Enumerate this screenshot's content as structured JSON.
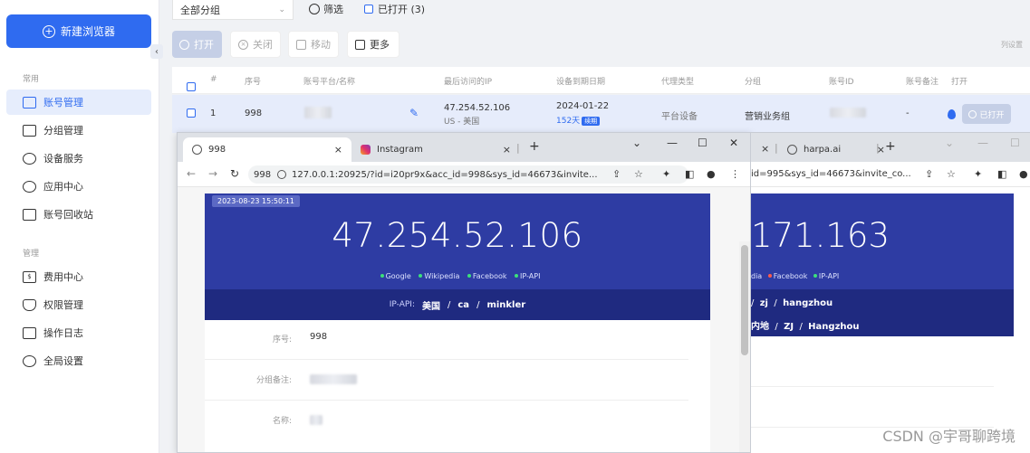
{
  "sidebar": {
    "new_browser": "新建浏览器",
    "section_common": "常用",
    "section_manage": "管理",
    "items": [
      {
        "label": "账号管理"
      },
      {
        "label": "分组管理"
      },
      {
        "label": "设备服务"
      },
      {
        "label": "应用中心"
      },
      {
        "label": "账号回收站"
      },
      {
        "label": "费用中心"
      },
      {
        "label": "权限管理"
      },
      {
        "label": "操作日志"
      },
      {
        "label": "全局设置"
      }
    ]
  },
  "filters": {
    "group_select": "全部分组",
    "filter_label": "筛选",
    "opened_label": "已打开 (3)"
  },
  "toolbar": {
    "open": "打开",
    "close": "关闭",
    "move": "移动",
    "more": "更多",
    "column_setting": "列设置"
  },
  "table": {
    "headers": [
      "#",
      "序号",
      "账号平台/名称",
      "最后访问的IP",
      "设备到期日期",
      "代理类型",
      "分组",
      "账号ID",
      "账号备注",
      "打开"
    ],
    "row": {
      "index": "1",
      "serial": "998",
      "ip": "47.254.52.106",
      "ip_location": "US - 美国",
      "expire_date": "2024-01-22",
      "expire_days": "152天",
      "renew": "续期",
      "proxy_type": "平台设备",
      "group": "营销业务组",
      "note": "-",
      "opened_btn": "已打开"
    }
  },
  "browser1": {
    "tabs": [
      {
        "title": "998",
        "close": "×"
      },
      {
        "title": "Instagram",
        "close": "×"
      }
    ],
    "new_tab": "+",
    "controls": {
      "min": "—",
      "max": "☐",
      "close": "✕",
      "chev": "⌄"
    },
    "addr_num": "998",
    "url": "127.0.0.1:20925/?id=i20pr9x&acc_id=998&sys_id=46673&invite...",
    "timestamp": "2023-08-23 15:50:11",
    "big_ip": "47.254.52.106",
    "services": [
      "Google",
      "Wikipedia",
      "Facebook",
      "IP-API"
    ],
    "ipapi_label": "IP-API:",
    "ipapi_country": "美国",
    "ipapi_region": "ca",
    "ipapi_city": "minkler",
    "details": [
      {
        "key": "序号:",
        "value": "998"
      },
      {
        "key": "分组备注:",
        "value": ""
      },
      {
        "key": "名称:",
        "value": ""
      }
    ]
  },
  "browser2": {
    "tabs": [
      {
        "title": "harpa.ai",
        "close": "×"
      }
    ],
    "tab_close_left": "×",
    "new_tab": "+",
    "url": "id=995&sys_id=46673&invite_co...",
    "big_ip": "171.163",
    "services": [
      "dia",
      "Facebook",
      "IP-API"
    ],
    "line1": [
      "zj",
      "hangzhou"
    ],
    "line2": [
      "内地",
      "ZJ",
      "Hangzhou"
    ]
  },
  "watermark": "CSDN @宇哥聊跨境",
  "colors": {
    "accent": "#2f6bf0",
    "ip_card": "#2e3ca3",
    "ip_band": "#1f2a80"
  }
}
